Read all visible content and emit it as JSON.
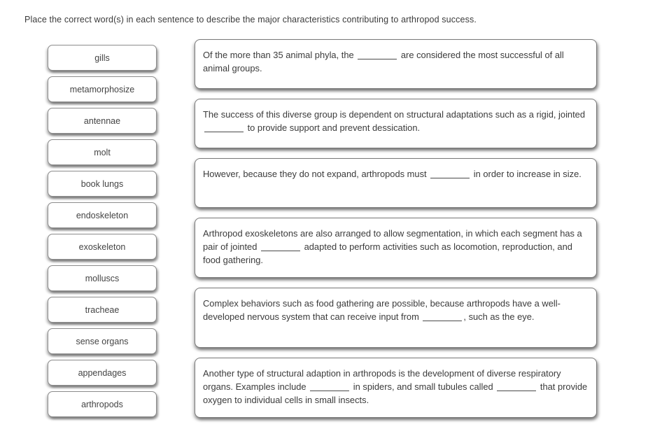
{
  "instruction": "Place the correct word(s) in each sentence to describe the major characteristics contributing to arthropod success.",
  "colors": {
    "page_background": "#ffffff",
    "text": "#3b3b3b",
    "chip_border": "#8c8c8c",
    "box_border": "#7a7a7a",
    "blank_rule": "#4a4a4a"
  },
  "word_bank": {
    "items": [
      {
        "label": "gills"
      },
      {
        "label": "metamorphosize"
      },
      {
        "label": "antennae"
      },
      {
        "label": "molt"
      },
      {
        "label": "book lungs"
      },
      {
        "label": "endoskeleton"
      },
      {
        "label": "exoskeleton"
      },
      {
        "label": "molluscs"
      },
      {
        "label": "tracheae"
      },
      {
        "label": "sense organs"
      },
      {
        "label": "appendages"
      },
      {
        "label": "arthropods"
      }
    ]
  },
  "sentences": [
    {
      "lines": 2,
      "segments": [
        {
          "type": "text",
          "value": "Of the more than 35 animal phyla, the "
        },
        {
          "type": "blank",
          "value": ""
        },
        {
          "type": "text",
          "value": " are considered the most successful of all animal groups."
        }
      ]
    },
    {
      "lines": 2,
      "segments": [
        {
          "type": "text",
          "value": "The success of this diverse group is dependent on structural adaptations such as a rigid, jointed "
        },
        {
          "type": "blank",
          "value": ""
        },
        {
          "type": "text",
          "value": " to provide support and prevent dessication."
        }
      ]
    },
    {
      "lines": 2,
      "segments": [
        {
          "type": "text",
          "value": "However, because they do not expand, arthropods must "
        },
        {
          "type": "blank",
          "value": ""
        },
        {
          "type": "text",
          "value": " in order to increase in size."
        }
      ]
    },
    {
      "lines": 3,
      "segments": [
        {
          "type": "text",
          "value": "Arthropod exoskeletons are also arranged to allow segmentation, in which each segment has a pair of jointed "
        },
        {
          "type": "blank",
          "value": ""
        },
        {
          "type": "text",
          "value": " adapted to perform activities such as locomotion, reproduction, and food gathering."
        }
      ]
    },
    {
      "lines": 3,
      "segments": [
        {
          "type": "text",
          "value": "Complex behaviors such as food gathering are possible, because arthropods have a well-developed nervous system that can receive input from "
        },
        {
          "type": "blank",
          "value": ""
        },
        {
          "type": "text",
          "value": ", such as the eye."
        }
      ]
    },
    {
      "lines": 3,
      "segments": [
        {
          "type": "text",
          "value": "Another type of structural adaption in arthropods is the development of diverse respiratory organs. Examples include "
        },
        {
          "type": "blank",
          "value": ""
        },
        {
          "type": "text",
          "value": " in spiders, and small tubules called "
        },
        {
          "type": "blank",
          "value": ""
        },
        {
          "type": "text",
          "value": " that provide oxygen to individual cells in small insects."
        }
      ]
    }
  ]
}
